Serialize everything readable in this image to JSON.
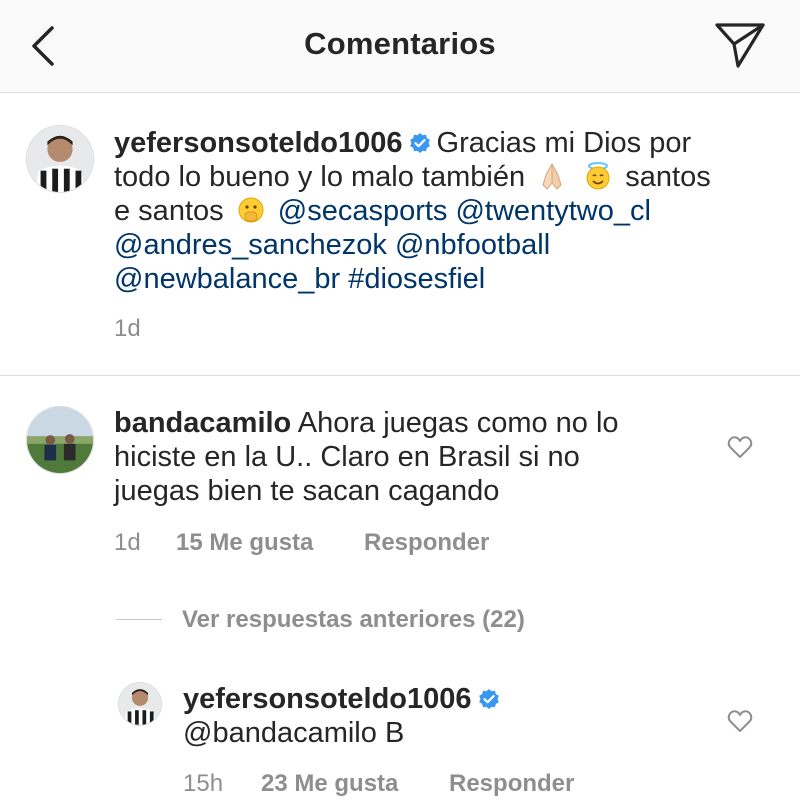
{
  "header": {
    "title": "Comentarios",
    "back_icon": "chevron-left-icon",
    "send_icon": "paper-plane-icon"
  },
  "caption": {
    "username": "yefersonsoteldo1006",
    "verified": true,
    "line1_rest": "Gracias mi Dios por",
    "line2": "todo lo bueno y lo malo también",
    "line2_after_emoji": "santos",
    "line3_start": "e santos",
    "line3_mentions": "@secasports @twentytwo_cl",
    "line4": "@andres_sanchezok @nbfootball",
    "line5": "@newbalance_br #diosesfiel",
    "emojis": [
      "folded-hands",
      "smiling-face-with-halo",
      "face-with-hand-over-mouth"
    ],
    "time": "1d"
  },
  "comments": [
    {
      "username": "bandacamilo",
      "line1": "Ahora juegas como no lo",
      "line2": "hiciste en la U.. Claro en Brasil si no",
      "line3": "juegas bien te sacan cagando",
      "time": "1d",
      "likes": "15 Me gusta",
      "reply_label": "Responder"
    }
  ],
  "view_previous": "Ver respuestas anteriores (22)",
  "reply": {
    "username": "yefersonsoteldo1006",
    "verified": true,
    "text": "@bandacamilo B",
    "time": "15h",
    "likes": "23 Me gusta",
    "reply_label": "Responder"
  },
  "colors": {
    "text": "#262626",
    "muted": "#8e8e8e",
    "verified_blue": "#3897f0",
    "mention": "#003569",
    "border": "#dbdbdb"
  }
}
